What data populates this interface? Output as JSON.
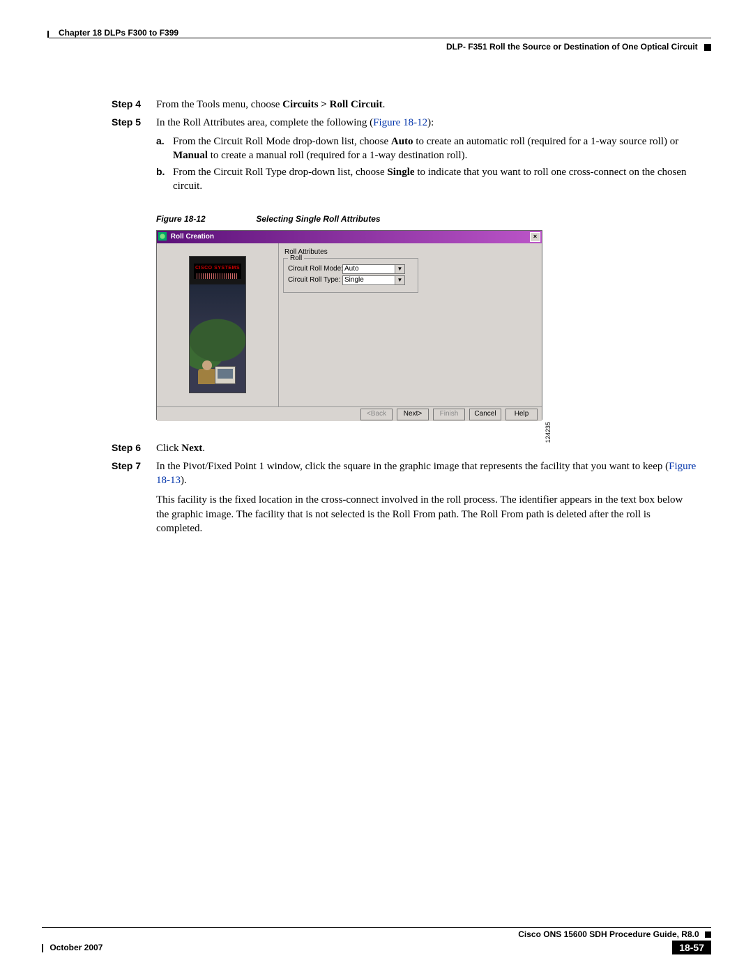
{
  "header": {
    "chapter": "Chapter 18  DLPs F300 to F399",
    "section": "DLP- F351 Roll the Source or Destination of One Optical Circuit"
  },
  "steps": {
    "s4": {
      "label": "Step 4",
      "textA": "From the Tools menu, choose ",
      "bold": "Circuits > Roll Circuit",
      "textB": "."
    },
    "s5": {
      "label": "Step 5",
      "textA": "In the Roll Attributes area, complete the following (",
      "link": "Figure 18-12",
      "textB": "):"
    },
    "s5a": {
      "label": "a.",
      "t1": "From the Circuit Roll Mode drop-down list, choose ",
      "b1": "Auto",
      "t2": " to create an automatic roll (required for a 1-way source roll) or ",
      "b2": "Manual",
      "t3": " to create a manual roll (required for a 1-way destination roll)."
    },
    "s5b": {
      "label": "b.",
      "t1": "From the Circuit Roll Type drop-down list, choose ",
      "b1": "Single",
      "t2": " to indicate that you want to roll one cross-connect on the chosen circuit."
    },
    "s6": {
      "label": "Step 6",
      "textA": "Click ",
      "bold": "Next",
      "textB": "."
    },
    "s7": {
      "label": "Step 7",
      "t1": "In the Pivot/Fixed Point 1 window, click the square in the graphic image that represents the facility that you want to keep (",
      "link": "Figure 18-13",
      "t2": ")."
    },
    "s7p2": "This facility is the fixed location in the cross-connect involved in the roll process. The identifier appears in the text box below the graphic image. The facility that is not selected is the Roll From path. The Roll From path is deleted after the roll is completed."
  },
  "figure": {
    "num": "Figure 18-12",
    "title": "Selecting Single Roll Attributes",
    "dialog_title": "Roll Creation",
    "panel_label": "Roll Attributes",
    "group_label": "Roll",
    "mode_label": "Circuit Roll Mode:",
    "mode_value": "Auto",
    "type_label": "Circuit Roll Type:",
    "type_value": "Single",
    "buttons": {
      "back": "<Back",
      "next": "Next>",
      "finish": "Finish",
      "cancel": "Cancel",
      "help": "Help"
    },
    "fig_id": "124235",
    "cisco": "CISCO SYSTEMS"
  },
  "footer": {
    "guide": "Cisco ONS 15600 SDH Procedure Guide, R8.0",
    "date": "October 2007",
    "page": "18-57"
  }
}
